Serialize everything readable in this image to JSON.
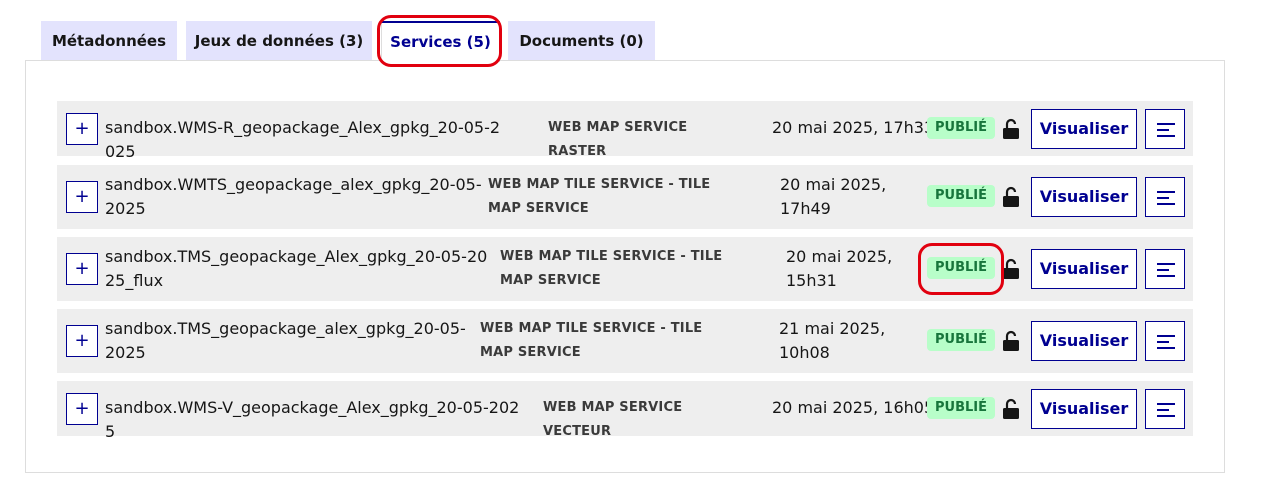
{
  "tabs": [
    {
      "label": "Métadonnées"
    },
    {
      "label": "Jeux de données (3)"
    },
    {
      "label": "Services (5)"
    },
    {
      "label": "Documents (0)"
    }
  ],
  "active_tab": "Services (5)",
  "services": [
    {
      "name": "sandbox.WMS-R_geopackage_Alex_gpkg_20-05-2025",
      "type": "WEB MAP SERVICE RASTER",
      "date": "20 mai 2025, 17h33",
      "status": "PUBLIÉ",
      "button": "Visualiser"
    },
    {
      "name": "sandbox.WMTS_geopackage_alex_gpkg_20-05-2025",
      "type": "WEB MAP TILE SERVICE - TILE MAP SERVICE",
      "date": "20 mai 2025, 17h49",
      "status": "PUBLIÉ",
      "button": "Visualiser"
    },
    {
      "name": "sandbox.TMS_geopackage_Alex_gpkg_20-05-2025_flux",
      "type": "WEB MAP TILE SERVICE - TILE MAP SERVICE",
      "date": "20 mai 2025, 15h31",
      "status": "PUBLIÉ",
      "button": "Visualiser"
    },
    {
      "name": "sandbox.TMS_geopackage_alex_gpkg_20-05-2025",
      "type": "WEB MAP TILE SERVICE - TILE MAP SERVICE",
      "date": "21 mai 2025, 10h08",
      "status": "PUBLIÉ",
      "button": "Visualiser"
    },
    {
      "name": "sandbox.WMS-V_geopackage_Alex_gpkg_20-05-2025",
      "type": "WEB MAP SERVICE VECTEUR",
      "date": "20 mai 2025, 16h05",
      "status": "PUBLIÉ",
      "button": "Visualiser"
    }
  ],
  "expand_symbol": "+",
  "icons": {
    "expand": "plus-icon",
    "lock": "unlocked-padlock-icon",
    "menu": "menu-lines-icon"
  },
  "colors": {
    "primary": "#000091",
    "tab_bg": "#e3e3fd",
    "row_bg": "#eeeeee",
    "badge_bg": "#b8fec9",
    "badge_text": "#18753c",
    "annotation": "#e1000f"
  }
}
